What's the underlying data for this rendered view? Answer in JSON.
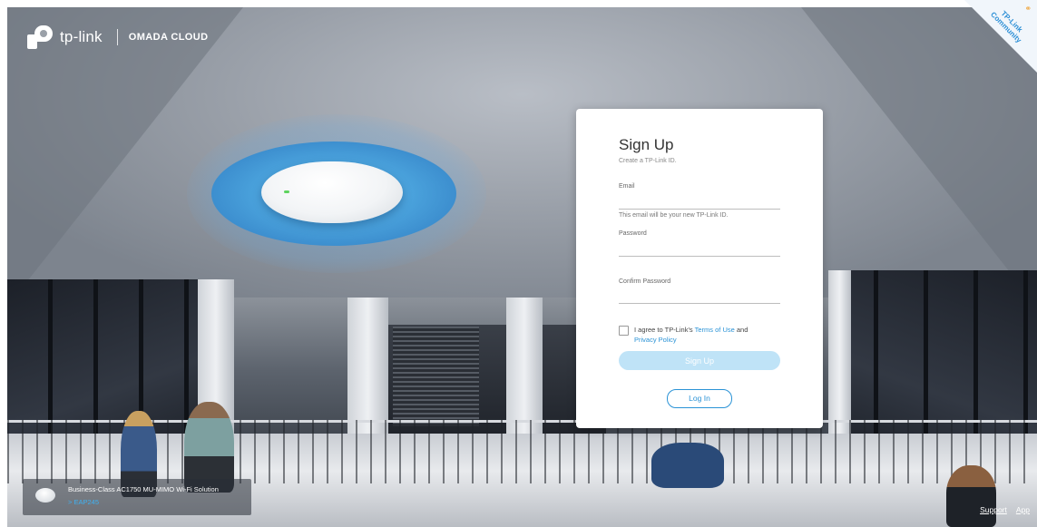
{
  "header": {
    "brand": "tp-link",
    "product": "OMADA CLOUD",
    "community_badge": "TP-Link Community"
  },
  "signup_card": {
    "title": "Sign Up",
    "subtitle": "Create a TP-Link ID.",
    "email_label": "Email",
    "email_value": "",
    "email_hint": "This email will be your new TP-Link ID.",
    "password_label": "Password",
    "password_value": "",
    "confirm_password_label": "Confirm Password",
    "confirm_password_value": "",
    "agree_prefix": "I agree to TP-Link's ",
    "terms_link": "Terms of Use",
    "agree_and": " and",
    "privacy_link": "Privacy Policy",
    "agree_checked": false,
    "signup_button": "Sign Up",
    "login_button": "Log In"
  },
  "product_banner": {
    "title": "Business-Class AC1750 MU-MIMO Wi-Fi Solution",
    "link": "> EAP245"
  },
  "footer": {
    "support": "Support",
    "app": "App"
  },
  "colors": {
    "accent": "#2b93d6",
    "signup_button_disabled": "#bfe3f7",
    "ap_glow": "#4aa2dc"
  },
  "icons": [
    "tp-link-logo-icon",
    "link-icon",
    "checkbox-icon",
    "access-point-thumb-icon"
  ]
}
